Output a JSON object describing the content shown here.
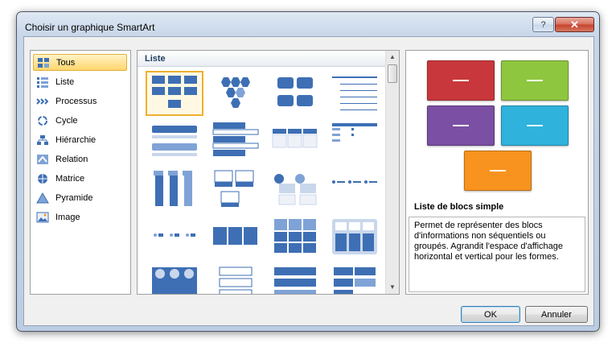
{
  "window": {
    "title": "Choisir un graphique SmartArt",
    "help_label": "?",
    "close_label": "✕"
  },
  "categories": [
    {
      "label": "Tous",
      "icon": "all-layouts-icon",
      "selected": true
    },
    {
      "label": "Liste",
      "icon": "list-icon",
      "selected": false
    },
    {
      "label": "Processus",
      "icon": "process-icon",
      "selected": false
    },
    {
      "label": "Cycle",
      "icon": "cycle-icon",
      "selected": false
    },
    {
      "label": "Hiérarchie",
      "icon": "hierarchy-icon",
      "selected": false
    },
    {
      "label": "Relation",
      "icon": "relationship-icon",
      "selected": false
    },
    {
      "label": "Matrice",
      "icon": "matrix-icon",
      "selected": false
    },
    {
      "label": "Pyramide",
      "icon": "pyramid-icon",
      "selected": false
    },
    {
      "label": "Image",
      "icon": "picture-icon",
      "selected": false
    }
  ],
  "gallery": {
    "header": "Liste"
  },
  "preview": {
    "name": "Liste de blocs simple",
    "description": "Permet de représenter des blocs d'informations non séquentiels ou groupés. Agrandit l'espace d'affichage horizontal et vertical pour les formes.",
    "colors": {
      "red": "#c8373b",
      "green": "#8ec63f",
      "purple": "#7b4fa3",
      "cyan": "#2fb2dc",
      "orange": "#f7931e"
    }
  },
  "buttons": {
    "ok": "OK",
    "cancel": "Annuler"
  }
}
